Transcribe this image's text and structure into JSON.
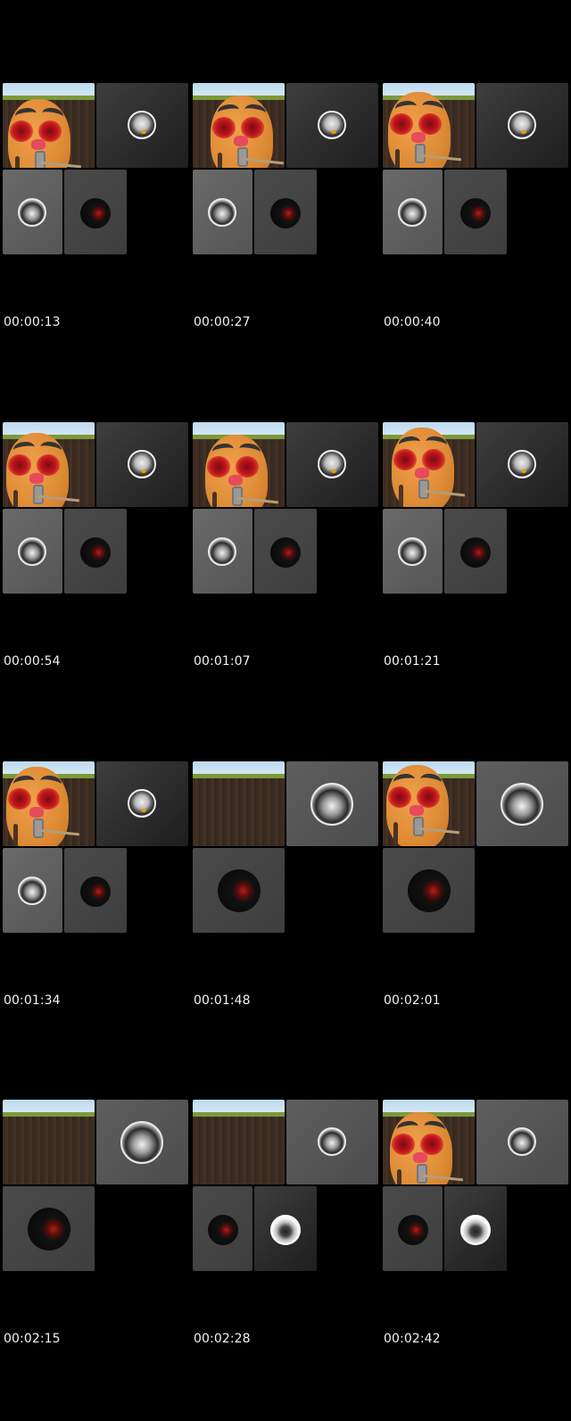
{
  "frames": [
    {
      "timestamp": "00:00:13",
      "layout": "potato-4"
    },
    {
      "timestamp": "00:00:27",
      "layout": "potato-4"
    },
    {
      "timestamp": "00:00:40",
      "layout": "potato-4"
    },
    {
      "timestamp": "00:00:54",
      "layout": "potato-4"
    },
    {
      "timestamp": "00:01:07",
      "layout": "potato-4"
    },
    {
      "timestamp": "00:01:21",
      "layout": "potato-4"
    },
    {
      "timestamp": "00:01:34",
      "layout": "potato-4"
    },
    {
      "timestamp": "00:01:48",
      "layout": "soil-3"
    },
    {
      "timestamp": "00:02:01",
      "layout": "potato-3"
    },
    {
      "timestamp": "00:02:15",
      "layout": "soil-3"
    },
    {
      "timestamp": "00:02:28",
      "layout": "soil-4"
    },
    {
      "timestamp": "00:02:42",
      "layout": "potato-4b"
    }
  ],
  "colors": {
    "background": "#000000",
    "timestamp_text": "#f2f2f2",
    "tile_dark": "#2a2a2a",
    "tile_light": "#5e5e5e"
  }
}
